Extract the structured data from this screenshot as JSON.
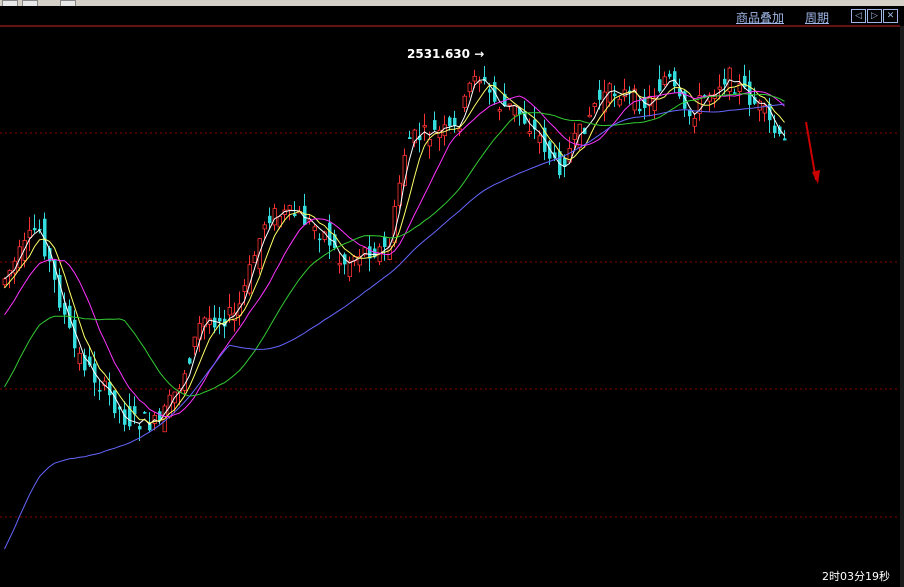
{
  "toolbar": {
    "overlay_label": "商品叠加",
    "period_label": "周期",
    "nav_prev": "◁",
    "nav_next": "▷",
    "nav_close": "✕"
  },
  "chart_data": {
    "type": "candlestick",
    "max_label": "2531.630",
    "ma_colors": [
      "#ffffff",
      "#ffff66",
      "#ff33ff",
      "#33cc33",
      "#6666ff"
    ],
    "colors": {
      "up": "#ff3333",
      "down": "#33dddd",
      "grid": "#8b0000",
      "arrow": "#cc0000"
    }
  },
  "status": {
    "timer": "2时03分19秒"
  }
}
